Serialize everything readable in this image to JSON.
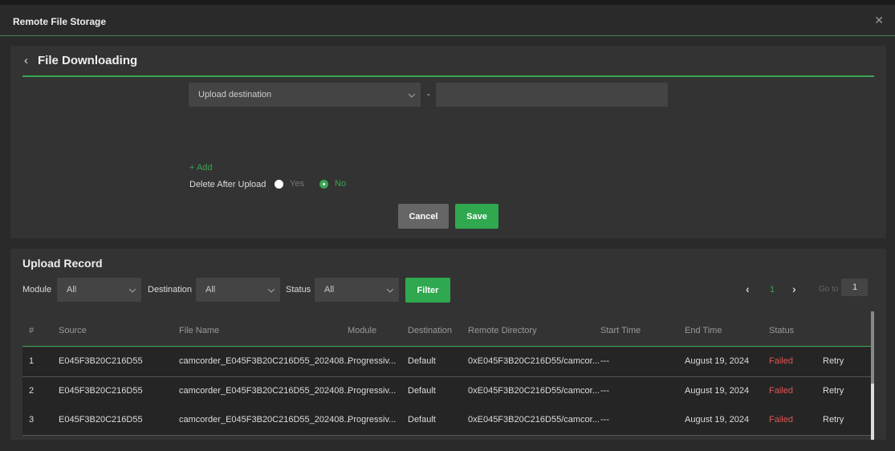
{
  "window": {
    "title": "Remote File Storage"
  },
  "form": {
    "title": "File Downloading",
    "destination_select": "Upload destination",
    "separator": "-",
    "path_value": "",
    "add_label": "+ Add",
    "delete_label": "Delete After Upload",
    "yes_label": "Yes",
    "no_label": "No",
    "selected": "No",
    "cancel_label": "Cancel",
    "save_label": "Save"
  },
  "record": {
    "title": "Upload Record",
    "module_label": "Module",
    "module_value": "All",
    "destination_label": "Destination",
    "destination_value": "All",
    "status_label": "Status",
    "status_value": "All",
    "filter_label": "Filter",
    "page": "1",
    "goto_label": "Go to",
    "goto_value": "1"
  },
  "table": {
    "headers": [
      "#",
      "Source",
      "File Name",
      "Module",
      "Destination",
      "Remote Directory",
      "Start Time",
      "End Time",
      "Status",
      ""
    ],
    "rows": [
      [
        "1",
        "E045F3B20C216D55",
        "camcorder_E045F3B20C216D55_202408...",
        "Progressiv...",
        "Default",
        "0xE045F3B20C216D55/camcor...",
        "---",
        "August 19, 2024",
        "Failed",
        "Retry"
      ],
      [
        "2",
        "E045F3B20C216D55",
        "camcorder_E045F3B20C216D55_202408...",
        "Progressiv...",
        "Default",
        "0xE045F3B20C216D55/camcor...",
        "---",
        "August 19, 2024",
        "Failed",
        "Retry"
      ],
      [
        "3",
        "E045F3B20C216D55",
        "camcorder_E045F3B20C216D55_202408...",
        "Progressiv...",
        "Default",
        "0xE045F3B20C216D55/camcor...",
        "---",
        "August 19, 2024",
        "Failed",
        "Retry"
      ]
    ]
  },
  "colors": {
    "accent": "#3aa552",
    "failed": "#e05555"
  }
}
